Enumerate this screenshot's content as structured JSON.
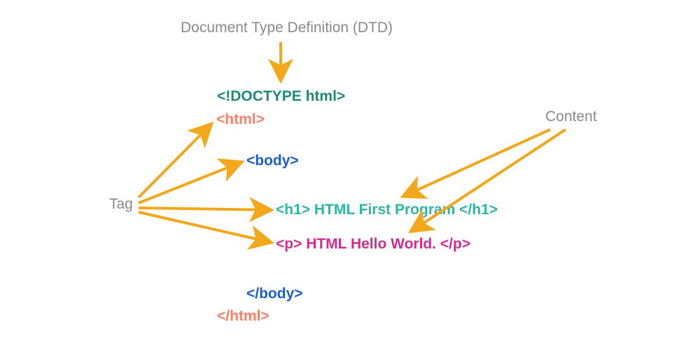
{
  "labels": {
    "dtd": "Document Type Definition (DTD)",
    "tag": "Tag",
    "content": "Content"
  },
  "code": {
    "doctype": "<!DOCTYPE html>",
    "html_open": "<html>",
    "body_open": "<body>",
    "h1_line": "<h1> HTML First Program </h1>",
    "p_line": "<p> HTML Hello World. </p>",
    "body_close": "</body>",
    "html_close": "</html>"
  },
  "colors": {
    "arrow": "#f3a81c",
    "label": "#8a8a8a",
    "doctype": "#1f8b76",
    "html": "#ff7f65",
    "body": "#1b5fcf",
    "h1": "#2bb8a3",
    "p": "#d42c8d"
  }
}
